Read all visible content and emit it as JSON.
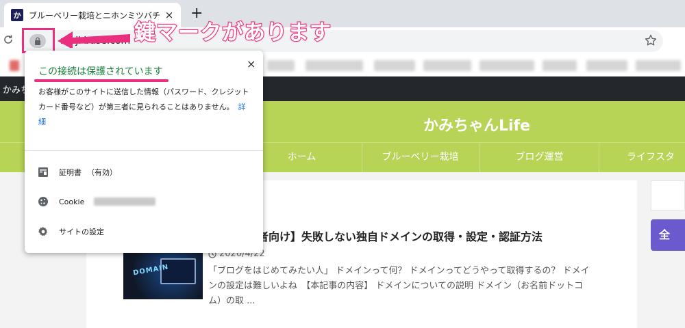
{
  "browser": {
    "tab": {
      "favicon_text": "か",
      "title": "ブルーベリー栽培とニホンミツバチ",
      "close": "×"
    },
    "new_tab": "+",
    "url": "moji base.com"
  },
  "annotation": {
    "text": "鍵マークがあります",
    "color": "#ea2f7e"
  },
  "security_popup": {
    "heading": "この接続は保護されています",
    "description": "お客様がこのサイトに送信した情報（パスワード、クレジット カード番号など）が第三者に見られることはありません。",
    "details_link": "詳細",
    "close": "×",
    "items": [
      {
        "icon": "certificate-icon",
        "label": "証明書",
        "status": "（有効）"
      },
      {
        "icon": "cookie-icon",
        "label": "Cookie"
      },
      {
        "icon": "gear-icon",
        "label": "サイトの設定"
      }
    ]
  },
  "site": {
    "top_bar_text": "かみち",
    "title": "かみちゃんLife",
    "nav": [
      "ホーム",
      "ブルーベリー栽培",
      "ブログ運営",
      "ライフスタ"
    ],
    "header_color": "#b7d456",
    "side_button": "全"
  },
  "article": {
    "title": "初心者向け】失敗しない独自ドメインの取得・設定・認証方法",
    "date": "2020/4/22",
    "excerpt": "「ブログをはじめてみたい人」 ドメインって何？ ドメインってどうやって取得するの？ ドメインの設定は難しいよね　【本記事の内容】 ドメインについての説明 ドメイン（お名前ドットコム）の取 ...",
    "thumbnail_text": "DOMAIN"
  }
}
